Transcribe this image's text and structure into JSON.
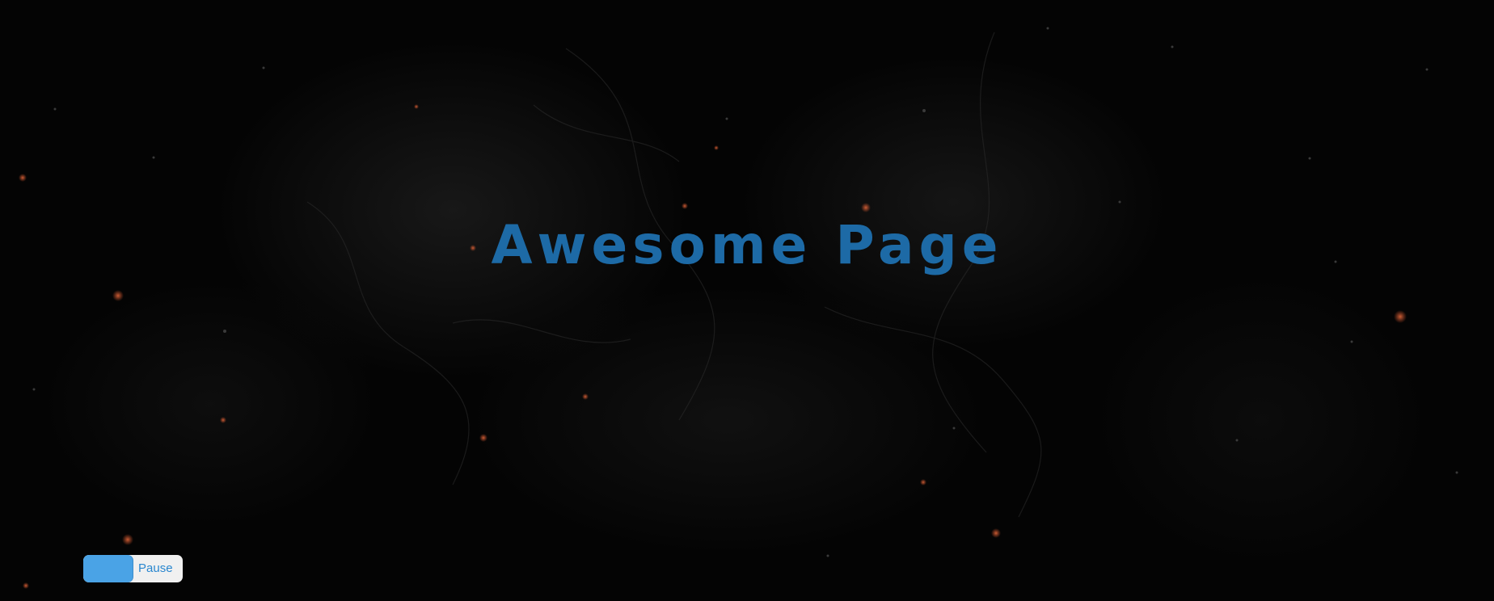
{
  "page": {
    "title": "Awesome Page"
  },
  "animation_toggle": {
    "label": "Pause"
  },
  "colors": {
    "background": "#030303",
    "title": "#1d6aa6",
    "toggle_knob": "#4aa3e6",
    "toggle_track": "#f0f0f0",
    "toggle_text": "#2a87cf",
    "ember": "#c8502a"
  }
}
